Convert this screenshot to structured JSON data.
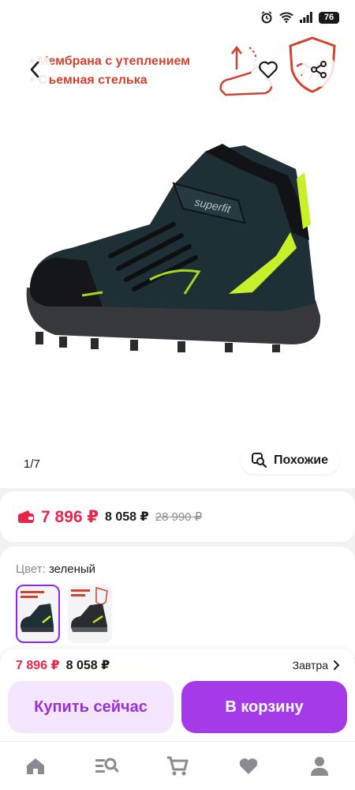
{
  "status_bar": {
    "battery": "76",
    "icons": [
      "alarm-icon",
      "wifi-icon",
      "signal-icon"
    ]
  },
  "gallery": {
    "banner_lines": [
      "Мембрана с утеплением",
      "Съемная стелька"
    ],
    "counter": "1/7",
    "similar_label": "Похожие",
    "shoe_brand": "superfit",
    "colors": {
      "accent": "#d2432f"
    }
  },
  "price": {
    "wallet_price": "7 896 ₽",
    "price": "8 058 ₽",
    "old_price": "28 990 ₽",
    "color_price": "#e5284a"
  },
  "color_select": {
    "label": "Цвет:",
    "value": "зеленый"
  },
  "bottom_bar": {
    "price_wallet": "7 896 ₽",
    "price": "8 058 ₽",
    "delivery": "Завтра",
    "buy_now_label": "Купить сейчас",
    "add_to_cart_label": "В корзину",
    "colors": {
      "primary": "#a53be8",
      "primary_light": "#f4e6ff"
    }
  },
  "tabbar": {
    "items": [
      "home-icon",
      "catalog-search-icon",
      "cart-icon",
      "favorites-icon",
      "profile-icon"
    ]
  }
}
